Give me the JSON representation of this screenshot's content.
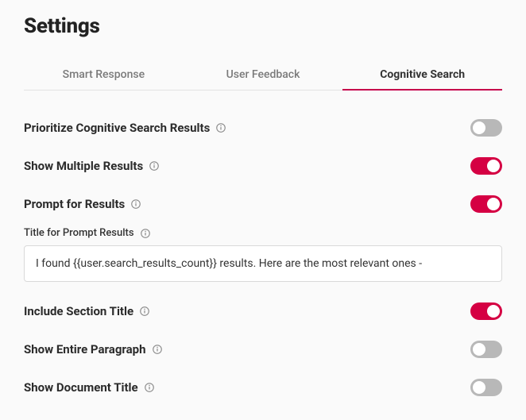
{
  "header": {
    "title": "Settings"
  },
  "tabs": [
    {
      "label": "Smart Response",
      "active": false
    },
    {
      "label": "User Feedback",
      "active": false
    },
    {
      "label": "Cognitive Search",
      "active": true
    }
  ],
  "settings": {
    "prioritize": {
      "label": "Prioritize Cognitive Search Results",
      "value": false
    },
    "multiple": {
      "label": "Show Multiple Results",
      "value": true
    },
    "prompt": {
      "label": "Prompt for Results",
      "value": true
    },
    "title_prompt": {
      "label": "Title for Prompt Results",
      "value": "I found {{user.search_results_count}} results. Here are the most relevant ones -"
    },
    "include_section": {
      "label": "Include Section Title",
      "value": true
    },
    "entire_paragraph": {
      "label": "Show Entire Paragraph",
      "value": false
    },
    "document_title": {
      "label": "Show Document Title",
      "value": false
    }
  }
}
